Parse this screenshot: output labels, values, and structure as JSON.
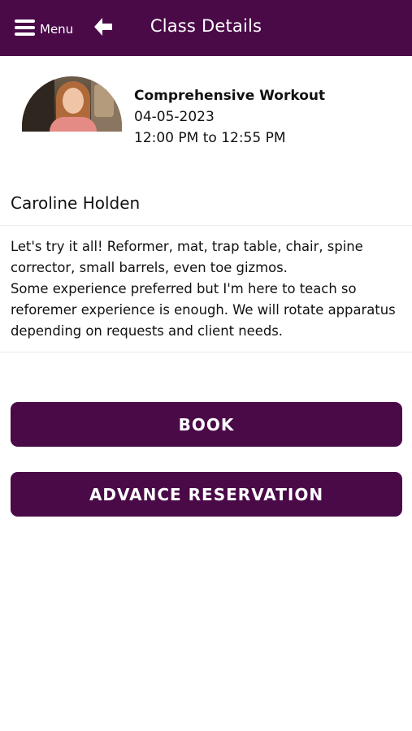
{
  "header": {
    "menu_label": "Menu",
    "title": "Class Details"
  },
  "class_info": {
    "name": "Comprehensive Workout",
    "date": "04-05-2023",
    "time": "12:00 PM to 12:55 PM"
  },
  "instructor": {
    "name": "Caroline Holden"
  },
  "description": {
    "line1": "Let's try it all! Reformer, mat, trap table, chair, spine corrector, small barrels, even toe gizmos.",
    "line2": "Some experience preferred but I'm here to teach so reforemer experience is enough. We will rotate apparatus depending on requests and client needs."
  },
  "actions": {
    "book_label": "BOOK",
    "advance_label": "ADVANCE RESERVATION"
  },
  "colors": {
    "brand": "#4a0a48",
    "background": "#ffffff",
    "text": "#111111"
  },
  "icons": {
    "menu": "hamburger-icon",
    "back": "arrow-left-icon"
  }
}
